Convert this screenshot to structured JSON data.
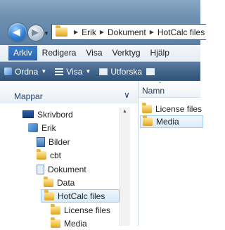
{
  "window": {
    "address": {
      "segments": [
        "Erik",
        "Dokument",
        "HotCalc files"
      ]
    },
    "menu": {
      "items": [
        "Arkiv",
        "Redigera",
        "Visa",
        "Verktyg",
        "Hjälp"
      ]
    },
    "commands": {
      "ordna": "Ordna",
      "visa": "Visa",
      "utforska": "Utforska"
    }
  },
  "nav_pane": {
    "title": "Mappar",
    "tree": [
      {
        "label": "Skrivbord",
        "icon": "desktop-icon"
      },
      {
        "label": "Erik",
        "icon": "user-folder-icon"
      },
      {
        "label": "Bilder",
        "icon": "pictures-folder-icon"
      },
      {
        "label": "cbt",
        "icon": "folder-icon"
      },
      {
        "label": "Dokument",
        "icon": "documents-folder-icon"
      },
      {
        "label": "Data",
        "icon": "folder-icon"
      },
      {
        "label": "HotCalc files",
        "icon": "folder-icon",
        "selected": true
      },
      {
        "label": "License files",
        "icon": "folder-icon"
      },
      {
        "label": "Media",
        "icon": "folder-icon"
      }
    ]
  },
  "file_list": {
    "column": "Namn",
    "rows": [
      {
        "name": "License files",
        "selected": false
      },
      {
        "name": "Media",
        "selected": true
      }
    ]
  },
  "colors": {
    "accent": "#2d63ae",
    "selection": "#d6eaf9"
  }
}
